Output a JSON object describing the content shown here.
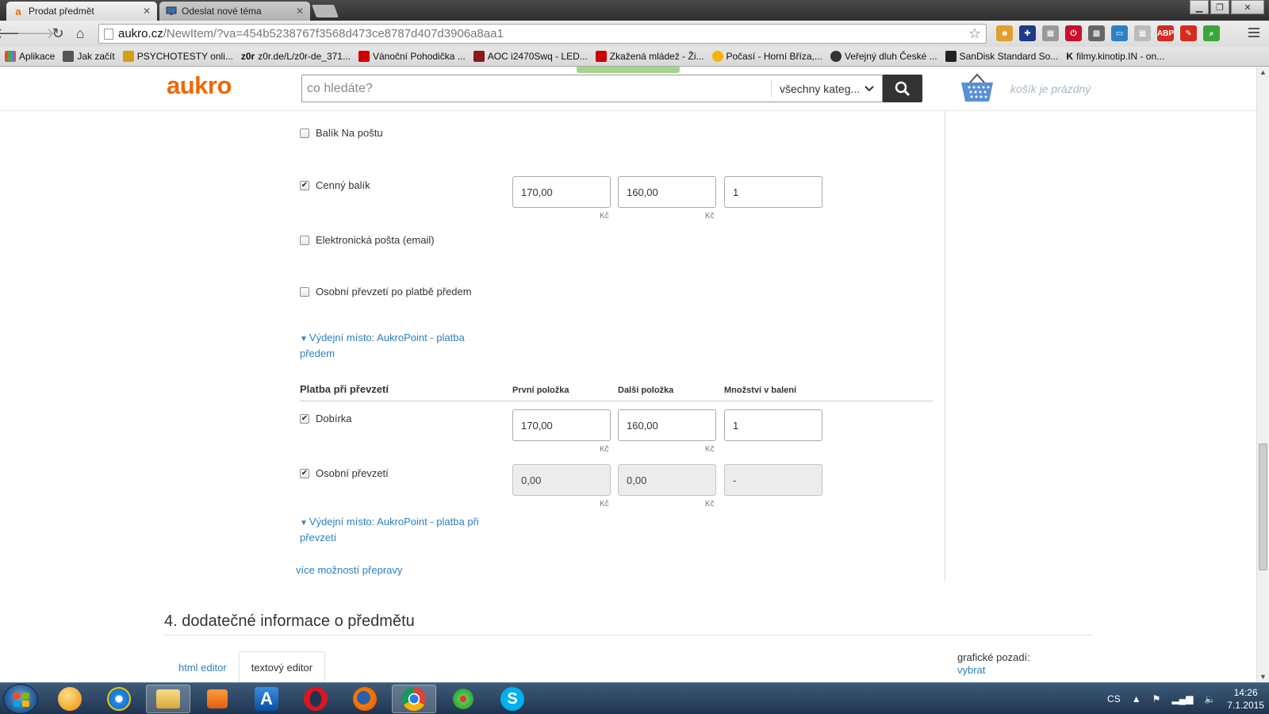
{
  "browser": {
    "tabs": [
      {
        "label": "Prodat předmět",
        "favicon": "a",
        "active": true
      },
      {
        "label": "Odeslat nové téma",
        "favicon": "monitor",
        "active": false
      }
    ],
    "url_host": "aukro.cz",
    "url_path": "/NewItem/?va=454b5238767f3568d473ce8787d407d3906a8aa1",
    "bookmarks": [
      "Aplikace",
      "Jak začít",
      "PSYCHOTESTY onli...",
      "z0r.de/L/z0r-de_371...",
      "Vánoční Pohodička ...",
      "AOC i2470Swq - LED...",
      "Zkažená mládež - Ži...",
      "Počasí - Horní Bříza,...",
      "Veřejný dluh České ...",
      "SanDisk Standard So...",
      "filmy.kinotip.IN - on..."
    ],
    "bookmark_prefixes": [
      "",
      "",
      "",
      "z0r",
      "",
      "",
      "",
      "",
      "",
      "",
      "K"
    ]
  },
  "header": {
    "logo": "aukro",
    "search_placeholder": "co hledáte?",
    "category": "všechny kateg...",
    "cart_text": "košík je prázdný"
  },
  "shipping": {
    "rows": [
      {
        "label": "Balík Na poštu",
        "checked": false
      },
      {
        "label": "Cenný balík",
        "checked": true,
        "first": "170,00",
        "next": "160,00",
        "qty": "1",
        "currency": "Kč"
      },
      {
        "label": "Elektronická pošta (email)",
        "checked": false
      },
      {
        "label": "Osobní převzetí po platbě předem",
        "checked": false
      }
    ],
    "pickup_link_1": "Výdejní místo: AukroPoint - platba předem",
    "payment_section": "Platba při převzetí",
    "col_first": "První položka",
    "col_next": "Další položka",
    "col_qty": "Množství v balení",
    "cod_rows": [
      {
        "label": "Dobírka",
        "checked": true,
        "first": "170,00",
        "next": "160,00",
        "qty": "1",
        "currency": "Kč"
      },
      {
        "label": "Osobní převzetí",
        "checked": true,
        "first": "0,00",
        "next": "0,00",
        "qty": "-",
        "currency": "Kč"
      }
    ],
    "pickup_link_2": "Výdejní místo: AukroPoint - platba při převzetí",
    "more_link": "více možností přepravy"
  },
  "section4": {
    "title": "4. dodatečné informace o předmětu",
    "tab_html": "html editor",
    "tab_text": "textový editor",
    "bg_label": "grafické pozadí:",
    "bg_link": "vybrat"
  },
  "taskbar": {
    "lang": "CS",
    "time": "14:26",
    "date": "7.1.2015"
  },
  "colors": {
    "brand": "#f06800",
    "link": "#2d7fc1"
  }
}
